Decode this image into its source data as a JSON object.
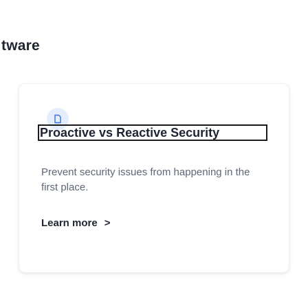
{
  "section": {
    "heading": "tware"
  },
  "card": {
    "icon": "document-icon",
    "title": "Proactive vs Reactive Security",
    "description": "Prevent security issues from happening in the first place.",
    "link_label": "Learn more",
    "link_chevron": ">"
  },
  "colors": {
    "icon_badge_bg": "#e3edfb",
    "icon_stroke": "#3d6fe0",
    "heading_text": "#1f2530",
    "body_text": "#5e6776"
  }
}
